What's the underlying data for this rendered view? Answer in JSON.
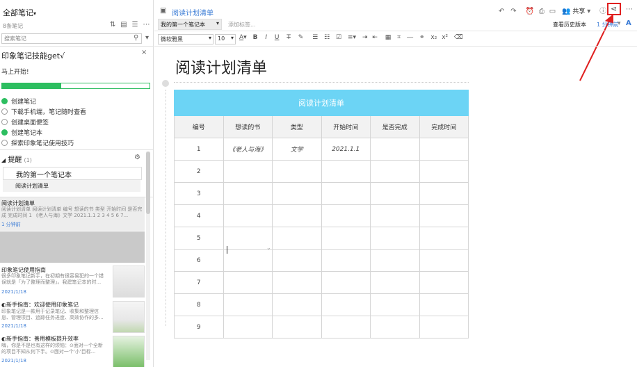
{
  "sidebar": {
    "notebook_title": "全部笔记",
    "note_count": "8条笔记",
    "search_placeholder": "搜索笔记",
    "onboarding": {
      "title": "印象笔记技能get√",
      "subtitle": "马上开始!",
      "progress": 0.4,
      "tasks": [
        {
          "label": "创建笔记",
          "done": true
        },
        {
          "label": "下载手机端，笔记随时查看",
          "done": false
        },
        {
          "label": "创建桌面便签",
          "done": false
        },
        {
          "label": "创建笔记本",
          "done": true
        },
        {
          "label": "探索印象笔记使用技巧",
          "done": false
        }
      ]
    },
    "reminders": {
      "label": "提醒",
      "count": "(1)",
      "notebook_name": "我的第一个笔记本",
      "item": "阅读计划清单"
    },
    "notes": [
      {
        "title": "阅读计划清单",
        "snippet": "阅读计划清单 阅读计划清单 编号 想读的书 类型 开始时间 是否完成 完成时间 1 《老人与海》文学 2021.1.1 2 3 4 5 6 7...",
        "date": "1 分钟前"
      },
      {
        "title": "印象笔记使用指南",
        "snippet": "很多印象笔记新手，在初期有很容易犯的一个错误就是「为了整理而整理」。我建笔记本的时...",
        "date": "2021/1/18"
      },
      {
        "title": "新手指南：欢迎使用印象笔记",
        "snippet": "印象笔记是一款用于记录笔记、收集和整理信息、管理项目、追踪任务进度、高效协作的多...",
        "date": "2021/1/18"
      },
      {
        "title": "新手指南：善用模板提升效率",
        "snippet": "嗨，你是不是也有这样的烦恼：⊙面对一个全新的项目不知从何下手。⊙面对一个'小'目标...",
        "date": "2021/1/18"
      }
    ]
  },
  "editor": {
    "note_title_tab": "阅读计划清单",
    "notebook_selector": "我的第一个笔记本",
    "add_tag": "添加标签...",
    "share_label": "共享",
    "history_label": "查看历史版本",
    "saved_time": "1 分钟前",
    "font_family": "微软雅黑",
    "font_size": "10",
    "doc_title": "阅读计划清单",
    "table": {
      "title": "阅读计划清单",
      "headers": [
        "编号",
        "想读的书",
        "类型",
        "开始时间",
        "是否完成",
        "完成时间"
      ],
      "rows": [
        [
          "1",
          "《老人与海》",
          "文学",
          "2021.1.1",
          "",
          ""
        ],
        [
          "2",
          "",
          "",
          "",
          "",
          ""
        ],
        [
          "3",
          "",
          "",
          "",
          "",
          ""
        ],
        [
          "4",
          "",
          "",
          "",
          "",
          ""
        ],
        [
          "5",
          "",
          "",
          "",
          "",
          ""
        ],
        [
          "6",
          "",
          "",
          "",
          "",
          ""
        ],
        [
          "7",
          "",
          "",
          "",
          "",
          ""
        ],
        [
          "8",
          "",
          "",
          "",
          "",
          ""
        ],
        [
          "9",
          "",
          "",
          "",
          "",
          ""
        ]
      ]
    }
  },
  "colors": {
    "table_header": "#6cd4f5",
    "annotation": "#e02020",
    "progress": "#2dbe60"
  }
}
